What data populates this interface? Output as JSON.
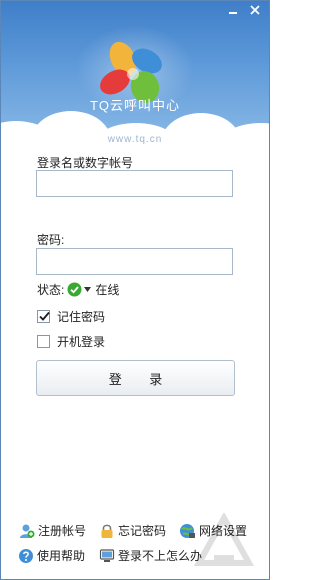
{
  "window": {
    "controls": [
      "minimize-icon",
      "close-icon"
    ]
  },
  "banner": {
    "brand_name": "TQ云呼叫中心",
    "brand_url": "www.tq.cn",
    "logo_colors": [
      "#e63b3b",
      "#f2b43a",
      "#6fbf3c",
      "#3f8fd8"
    ]
  },
  "form": {
    "account_label": "登录名或数字帐号",
    "account_value": "",
    "password_label": "密码:",
    "password_value": "",
    "status_label": "状态:",
    "status_value": "在线",
    "remember_label": "记住密码",
    "remember_checked": true,
    "autostart_label": "开机登录",
    "autostart_checked": false,
    "login_label": "登 录"
  },
  "links": {
    "register": "注册帐号",
    "forgot": "忘记密码",
    "network": "网络设置",
    "help": "使用帮助",
    "cant_login": "登录不上怎么办"
  },
  "colors": {
    "banner_top": "#3f7fc9",
    "banner_bottom": "#8fbde8",
    "status_green": "#3aa832"
  }
}
